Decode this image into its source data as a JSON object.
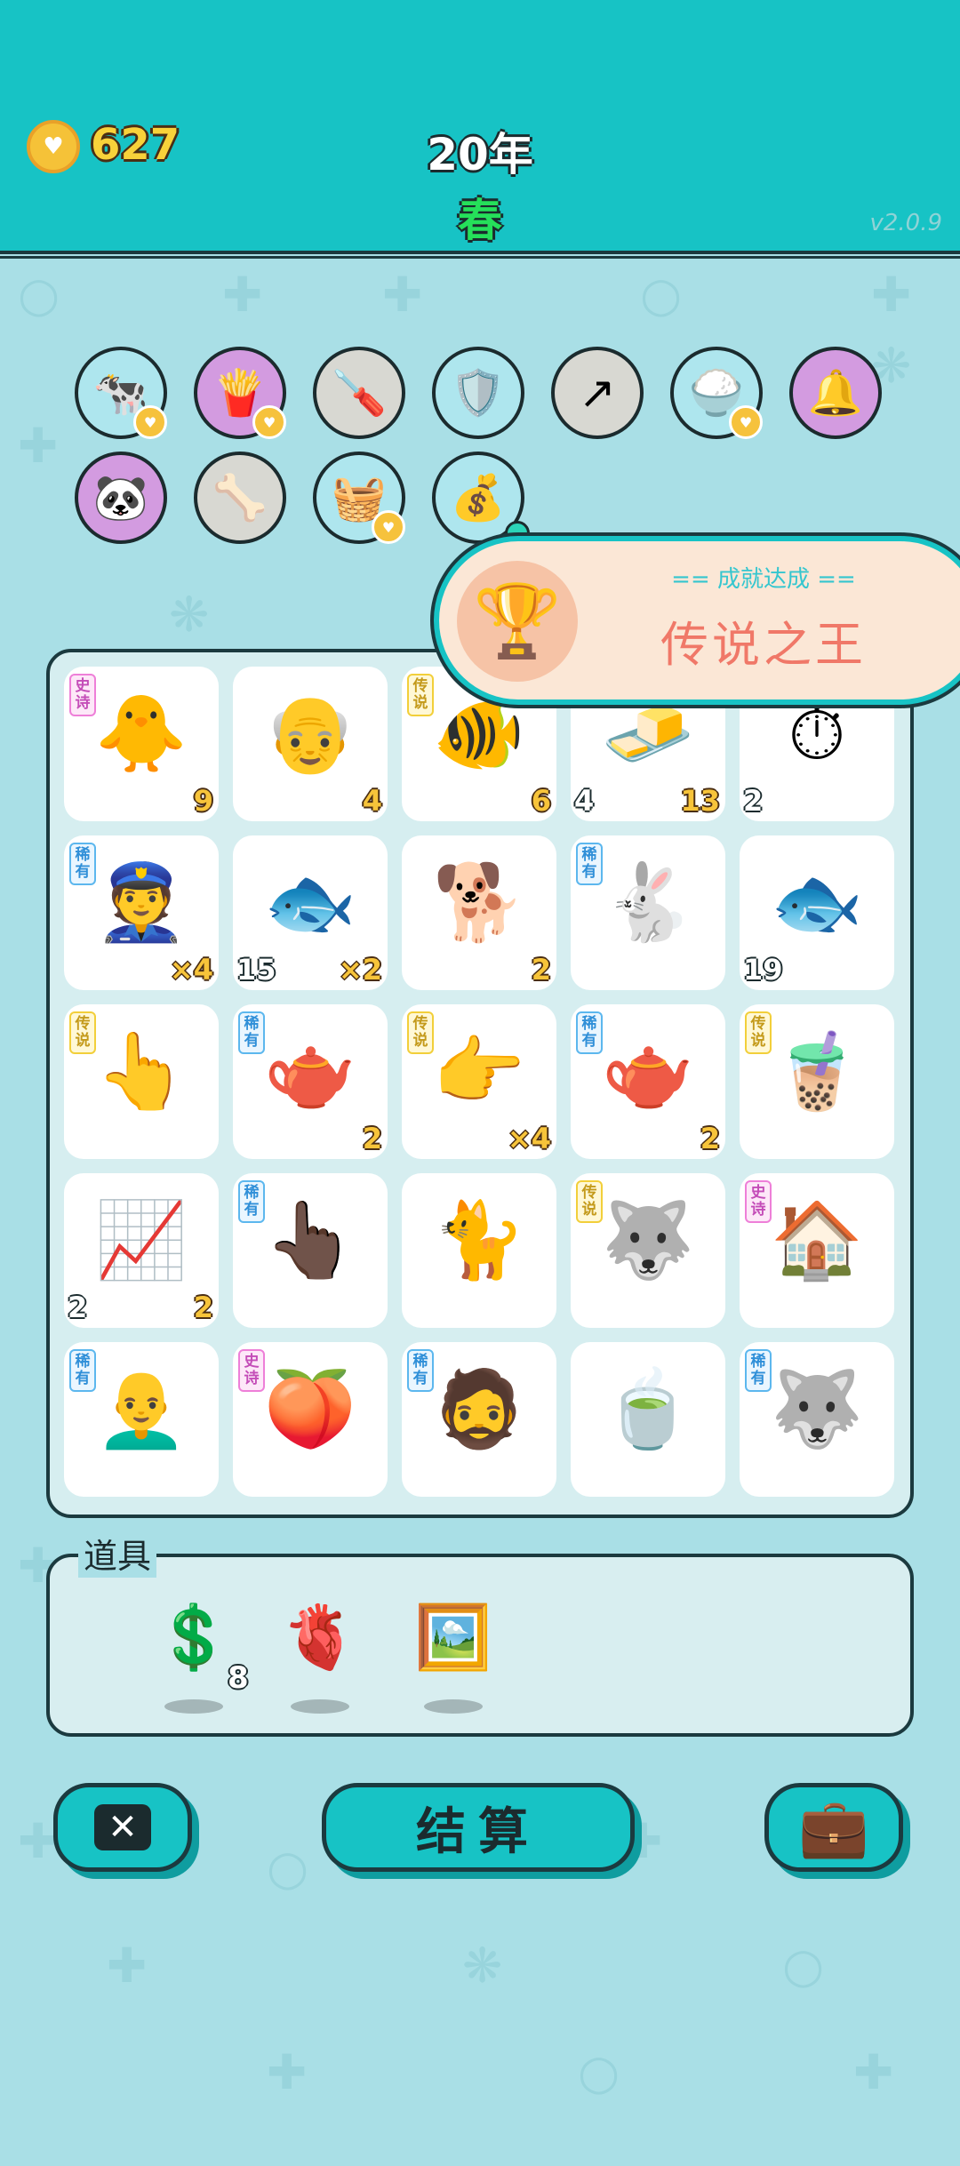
{
  "header": {
    "coins": "627",
    "year": "20年",
    "season": "春",
    "version": "v2.0.9"
  },
  "relics": [
    {
      "icon": "cow-pair-icon",
      "glyph": "🐄",
      "bg": "#aee6ee",
      "badge": true
    },
    {
      "icon": "fries-icon",
      "glyph": "🍟",
      "bg": "#d39be0",
      "badge": true
    },
    {
      "icon": "screwdriver-icon",
      "glyph": "🪛",
      "bg": "#d8d8d2",
      "badge": false
    },
    {
      "icon": "shield-wrench-icon",
      "glyph": "🛡️",
      "bg": "#aee6ee",
      "badge": false
    },
    {
      "icon": "upgrade-arrow-icon",
      "glyph": "↗",
      "bg": "#d8d8d2",
      "badge": false
    },
    {
      "icon": "rice-bowl-icon",
      "glyph": "🍚",
      "bg": "#aee6ee",
      "badge": true
    },
    {
      "icon": "bell-box-icon",
      "glyph": "🔔",
      "bg": "#d39be0",
      "badge": false
    },
    {
      "icon": "panda-icon",
      "glyph": "🐼",
      "bg": "#d39be0",
      "badge": false
    },
    {
      "icon": "dog-food-bowl-icon",
      "glyph": "🦴",
      "bg": "#d8d8d2",
      "badge": false
    },
    {
      "icon": "fruit-basket-icon",
      "glyph": "🧺",
      "bg": "#aee6ee",
      "badge": true
    },
    {
      "icon": "seed-bag-icon",
      "glyph": "💰",
      "bg": "#aee6ee",
      "badge": false
    }
  ],
  "achievement": {
    "title": "== 成就达成 ==",
    "name": "传说之王"
  },
  "grid": [
    {
      "icon": "chick-icon",
      "glyph": "🐥",
      "tag": "史诗",
      "tagType": "epic",
      "left": "",
      "right": "9"
    },
    {
      "icon": "old-man-icon",
      "glyph": "👴",
      "tag": "",
      "tagType": "",
      "left": "",
      "right": "4"
    },
    {
      "icon": "koi-fish-icon",
      "glyph": "🐠",
      "tag": "传说",
      "tagType": "legend",
      "left": "",
      "right": "6"
    },
    {
      "icon": "gold-bars-icon",
      "glyph": "🧈",
      "tag": "",
      "tagType": "",
      "left": "4",
      "right": "13"
    },
    {
      "icon": "stopwatch-icon",
      "glyph": "⏱",
      "tag": "",
      "tagType": "",
      "left": "2",
      "right": ""
    },
    {
      "icon": "police-officer-icon",
      "glyph": "👮",
      "tag": "稀有",
      "tagType": "rare",
      "left": "",
      "right": "×4"
    },
    {
      "icon": "fish-icon",
      "glyph": "🐟",
      "tag": "",
      "tagType": "",
      "left": "15",
      "right": "×2"
    },
    {
      "icon": "brown-dog-icon",
      "glyph": "🐕",
      "tag": "",
      "tagType": "",
      "left": "",
      "right": "2"
    },
    {
      "icon": "rabbit-icon",
      "glyph": "🐇",
      "tag": "稀有",
      "tagType": "rare",
      "left": "",
      "right": ""
    },
    {
      "icon": "fish-icon",
      "glyph": "🐟",
      "tag": "",
      "tagType": "",
      "left": "19",
      "right": ""
    },
    {
      "icon": "pointing-hand-icon",
      "glyph": "👆",
      "tag": "传说",
      "tagType": "legend",
      "left": "",
      "right": ""
    },
    {
      "icon": "teapot-icon",
      "glyph": "🫖",
      "tag": "稀有",
      "tagType": "rare",
      "left": "",
      "right": "2"
    },
    {
      "icon": "pointing-hand-icon",
      "glyph": "👉",
      "tag": "传说",
      "tagType": "legend",
      "left": "",
      "right": "×4"
    },
    {
      "icon": "teapot-icon",
      "glyph": "🫖",
      "tag": "稀有",
      "tagType": "rare",
      "left": "",
      "right": "2"
    },
    {
      "icon": "bubble-tea-icon",
      "glyph": "🧋",
      "tag": "传说",
      "tagType": "legend",
      "left": "",
      "right": ""
    },
    {
      "icon": "chart-card-icon",
      "glyph": "📈",
      "tag": "",
      "tagType": "",
      "left": "2",
      "right": "2"
    },
    {
      "icon": "brown-hand-icon",
      "glyph": "👆🏿",
      "tag": "稀有",
      "tagType": "rare",
      "left": "",
      "right": ""
    },
    {
      "icon": "yellow-cat-icon",
      "glyph": "🐈",
      "tag": "",
      "tagType": "",
      "left": "",
      "right": ""
    },
    {
      "icon": "husky-king-icon",
      "glyph": "🐺",
      "tag": "传说",
      "tagType": "legend",
      "left": "",
      "right": ""
    },
    {
      "icon": "pet-house-icon",
      "glyph": "🏠",
      "tag": "史诗",
      "tagType": "epic",
      "left": "",
      "right": ""
    },
    {
      "icon": "bald-man-icon",
      "glyph": "👨‍🦲",
      "tag": "稀有",
      "tagType": "rare",
      "left": "",
      "right": ""
    },
    {
      "icon": "peach-icon",
      "glyph": "🍑",
      "tag": "史诗",
      "tagType": "epic",
      "left": "",
      "right": ""
    },
    {
      "icon": "bucket-hat-man-icon",
      "glyph": "🧔",
      "tag": "稀有",
      "tagType": "rare",
      "left": "",
      "right": ""
    },
    {
      "icon": "tea-bowl-icon",
      "glyph": "🍵",
      "tag": "",
      "tagType": "",
      "left": "",
      "right": ""
    },
    {
      "icon": "husky-dog-icon",
      "glyph": "🐺",
      "tag": "稀有",
      "tagType": "rare",
      "left": "",
      "right": ""
    }
  ],
  "items": {
    "title": "道具",
    "list": [
      {
        "icon": "dollar-coin-icon",
        "glyph": "💲",
        "count": "8"
      },
      {
        "icon": "liver-icon",
        "glyph": "🫀",
        "count": ""
      },
      {
        "icon": "framed-cow-portrait-icon",
        "glyph": "🖼️",
        "count": ""
      }
    ]
  },
  "buttons": {
    "settle": "结算"
  }
}
